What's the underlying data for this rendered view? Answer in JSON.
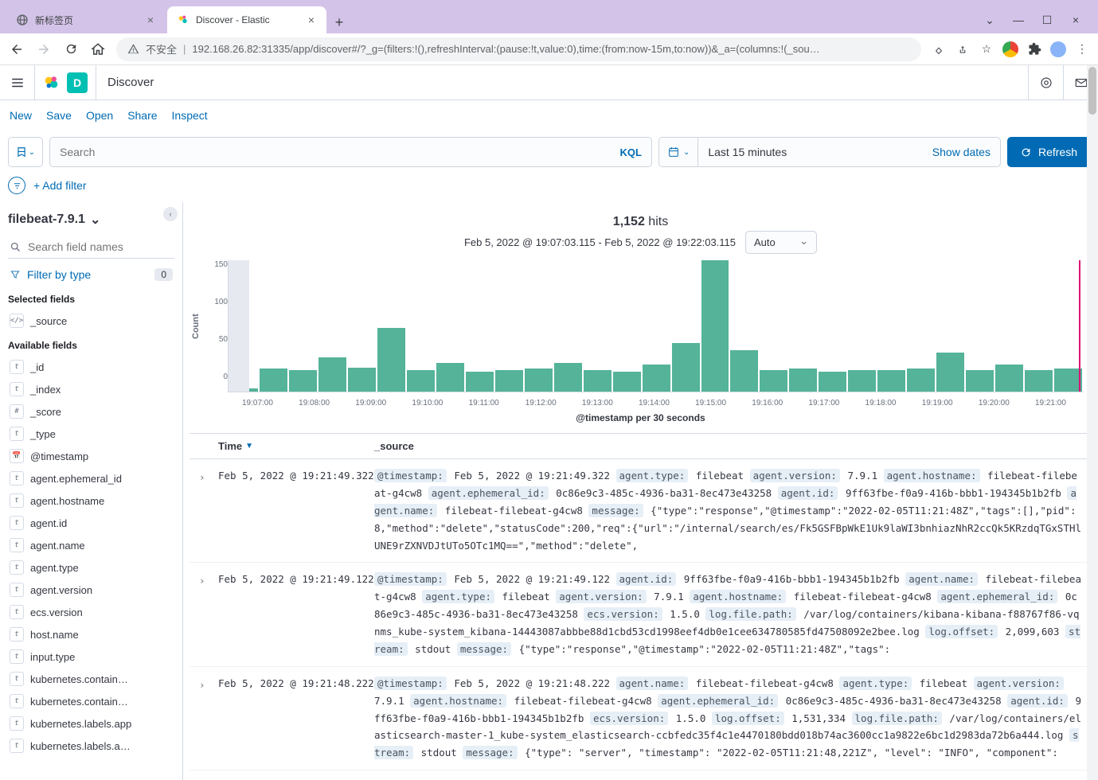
{
  "browser": {
    "tabs": [
      {
        "title": "新标签页",
        "active": false
      },
      {
        "title": "Discover - Elastic",
        "active": true
      }
    ],
    "insecure_label": "不安全",
    "url": "192.168.26.82:31335/app/discover#/?_g=(filters:!(),refreshInterval:(pause:!t,value:0),time:(from:now-15m,to:now))&_a=(columns:!(_sou…"
  },
  "header": {
    "app_initial": "D",
    "app_title": "Discover"
  },
  "toolbar": {
    "new": "New",
    "save": "Save",
    "open": "Open",
    "share": "Share",
    "inspect": "Inspect"
  },
  "search": {
    "placeholder": "Search",
    "kql": "KQL",
    "date": "Last 15 minutes",
    "show_dates": "Show dates",
    "refresh": "Refresh",
    "add_filter": "+ Add filter"
  },
  "sidebar": {
    "index_pattern": "filebeat-7.9.1",
    "search_placeholder": "Search field names",
    "filter_by_type": "Filter by type",
    "filter_count": "0",
    "selected_label": "Selected fields",
    "available_label": "Available fields",
    "selected": [
      {
        "type": "src",
        "name": "_source"
      }
    ],
    "available": [
      {
        "type": "t",
        "name": "_id"
      },
      {
        "type": "t",
        "name": "_index"
      },
      {
        "type": "#",
        "name": "_score"
      },
      {
        "type": "t",
        "name": "_type"
      },
      {
        "type": "cal",
        "name": "@timestamp"
      },
      {
        "type": "t",
        "name": "agent.ephemeral_id"
      },
      {
        "type": "t",
        "name": "agent.hostname"
      },
      {
        "type": "t",
        "name": "agent.id"
      },
      {
        "type": "t",
        "name": "agent.name"
      },
      {
        "type": "t",
        "name": "agent.type"
      },
      {
        "type": "t",
        "name": "agent.version"
      },
      {
        "type": "t",
        "name": "ecs.version"
      },
      {
        "type": "t",
        "name": "host.name"
      },
      {
        "type": "t",
        "name": "input.type"
      },
      {
        "type": "t",
        "name": "kubernetes.contain…"
      },
      {
        "type": "t",
        "name": "kubernetes.contain…"
      },
      {
        "type": "t",
        "name": "kubernetes.labels.app"
      },
      {
        "type": "t",
        "name": "kubernetes.labels.a…"
      }
    ]
  },
  "hits": {
    "count": "1,152",
    "label": "hits"
  },
  "timerange": "Feb 5, 2022 @ 19:07:03.115 - Feb 5, 2022 @ 19:22:03.115",
  "interval": "Auto",
  "chart_data": {
    "type": "bar",
    "ylabel": "Count",
    "xlabel": "@timestamp per 30 seconds",
    "yticks": [
      "150",
      "100",
      "50",
      "0"
    ],
    "xticks": [
      "19:07:00",
      "19:08:00",
      "19:09:00",
      "19:10:00",
      "19:11:00",
      "19:12:00",
      "19:13:00",
      "19:14:00",
      "19:15:00",
      "19:16:00",
      "19:17:00",
      "19:18:00",
      "19:19:00",
      "19:20:00",
      "19:21:00"
    ],
    "values": [
      5,
      32,
      30,
      48,
      34,
      90,
      30,
      40,
      28,
      30,
      32,
      40,
      30,
      28,
      38,
      68,
      185,
      58,
      30,
      32,
      28,
      30,
      30,
      32,
      55,
      30,
      38,
      30,
      32
    ]
  },
  "table": {
    "time_col": "Time",
    "source_col": "_source",
    "rows": [
      {
        "time": "Feb 5, 2022 @ 19:21:49.322",
        "fields": [
          {
            "k": "@timestamp:",
            "v": "Feb 5, 2022 @ 19:21:49.322"
          },
          {
            "k": "agent.type:",
            "v": "filebeat"
          },
          {
            "k": "agent.version:",
            "v": "7.9.1"
          },
          {
            "k": "agent.hostname:",
            "v": "filebeat-filebeat-g4cw8"
          },
          {
            "k": "agent.ephemeral_id:",
            "v": "0c86e9c3-485c-4936-ba31-8ec473e43258"
          },
          {
            "k": "agent.id:",
            "v": "9ff63fbe-f0a9-416b-bbb1-194345b1b2fb"
          },
          {
            "k": "agent.name:",
            "v": "filebeat-filebeat-g4cw8"
          },
          {
            "k": "message:",
            "v": "{\"type\":\"response\",\"@timestamp\":\"2022-02-05T11:21:48Z\",\"tags\":[],\"pid\":8,\"method\":\"delete\",\"statusCode\":200,\"req\":{\"url\":\"/internal/search/es/Fk5GSFBpWkE1Uk9laWI3bnhiazNhR2ccQk5KRzdqTGxSTHlUNE9rZXNVDJtUTo5OTc1MQ==\",\"method\":\"delete\","
          }
        ]
      },
      {
        "time": "Feb 5, 2022 @ 19:21:49.122",
        "fields": [
          {
            "k": "@timestamp:",
            "v": "Feb 5, 2022 @ 19:21:49.122"
          },
          {
            "k": "agent.id:",
            "v": "9ff63fbe-f0a9-416b-bbb1-194345b1b2fb"
          },
          {
            "k": "agent.name:",
            "v": "filebeat-filebeat-g4cw8"
          },
          {
            "k": "agent.type:",
            "v": "filebeat"
          },
          {
            "k": "agent.version:",
            "v": "7.9.1"
          },
          {
            "k": "agent.hostname:",
            "v": "filebeat-filebeat-g4cw8"
          },
          {
            "k": "agent.ephemeral_id:",
            "v": "0c86e9c3-485c-4936-ba31-8ec473e43258"
          },
          {
            "k": "ecs.version:",
            "v": "1.5.0"
          },
          {
            "k": "log.file.path:",
            "v": "/var/log/containers/kibana-kibana-f88767f86-vqnms_kube-system_kibana-14443087abbbe88d1cbd53cd1998eef4db0e1cee634780585fd47508092e2bee.log"
          },
          {
            "k": "log.offset:",
            "v": "2,099,603"
          },
          {
            "k": "stream:",
            "v": "stdout"
          },
          {
            "k": "message:",
            "v": "{\"type\":\"response\",\"@timestamp\":\"2022-02-05T11:21:48Z\",\"tags\":"
          }
        ]
      },
      {
        "time": "Feb 5, 2022 @ 19:21:48.222",
        "fields": [
          {
            "k": "@timestamp:",
            "v": "Feb 5, 2022 @ 19:21:48.222"
          },
          {
            "k": "agent.name:",
            "v": "filebeat-filebeat-g4cw8"
          },
          {
            "k": "agent.type:",
            "v": "filebeat"
          },
          {
            "k": "agent.version:",
            "v": "7.9.1"
          },
          {
            "k": "agent.hostname:",
            "v": "filebeat-filebeat-g4cw8"
          },
          {
            "k": "agent.ephemeral_id:",
            "v": "0c86e9c3-485c-4936-ba31-8ec473e43258"
          },
          {
            "k": "agent.id:",
            "v": "9ff63fbe-f0a9-416b-bbb1-194345b1b2fb"
          },
          {
            "k": "ecs.version:",
            "v": "1.5.0"
          },
          {
            "k": "log.offset:",
            "v": "1,531,334"
          },
          {
            "k": "log.file.path:",
            "v": "/var/log/containers/elasticsearch-master-1_kube-system_elasticsearch-ccbfedc35f4c1e4470180bdd018b74ac3600cc1a9822e6bc1d2983da72b6a444.log"
          },
          {
            "k": "stream:",
            "v": "stdout"
          },
          {
            "k": "message:",
            "v": "{\"type\": \"server\", \"timestamp\": \"2022-02-05T11:21:48,221Z\", \"level\": \"INFO\", \"component\":"
          }
        ]
      }
    ]
  }
}
